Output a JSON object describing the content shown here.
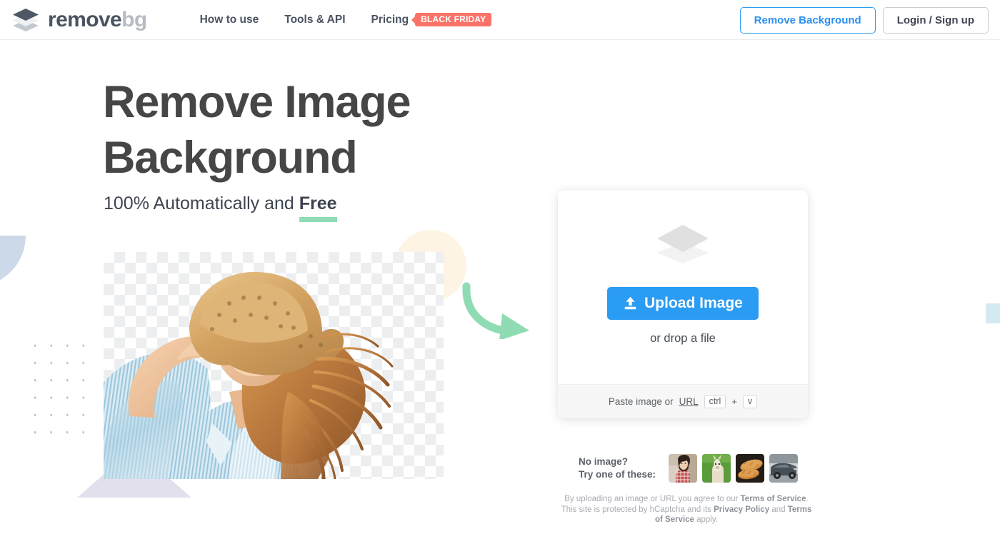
{
  "header": {
    "logo": {
      "name": "removebg-logo",
      "text_primary": "remove",
      "text_secondary": "bg"
    },
    "nav": [
      {
        "label": "How to use",
        "name": "nav-how-to-use"
      },
      {
        "label": "Tools & API",
        "name": "nav-tools-api"
      },
      {
        "label": "Pricing",
        "name": "nav-pricing"
      }
    ],
    "promo_badge": "BLACK FRIDAY",
    "promo_badge_color": "#fa7268",
    "remove_background_button": "Remove Background",
    "login_button": "Login / Sign up",
    "accent_blue": "#2a8ff0"
  },
  "hero": {
    "title_line1": "Remove Image",
    "title_line2": "Background",
    "subtitle_prefix": "100% Automatically and ",
    "subtitle_highlight": "Free",
    "highlight_underline_color": "#8fdcb4",
    "title_color": "#464646"
  },
  "upload": {
    "button_label": "Upload Image",
    "button_color": "#2b9cf4",
    "drop_text": "or drop a file",
    "paste_prefix": "Paste image or ",
    "paste_url_label": "URL",
    "key_ctrl": "ctrl",
    "key_plus": "+",
    "key_v": "v"
  },
  "samples": {
    "label_line1": "No image?",
    "label_line2": "Try one of these:",
    "thumbnails": [
      {
        "name": "sample-woman-plaid",
        "alt": "woman in plaid shirt"
      },
      {
        "name": "sample-alpaca",
        "alt": "alpaca on grass"
      },
      {
        "name": "sample-bread",
        "alt": "loaves of bread"
      },
      {
        "name": "sample-car",
        "alt": "dark grey car"
      }
    ]
  },
  "legal": {
    "part1": "By uploading an image or URL you agree to our ",
    "terms1": "Terms of Service",
    "part2": ". This site is protected by hCaptcha and its ",
    "privacy": "Privacy Policy",
    "part3": " and ",
    "terms2": "Terms of Service",
    "part4": " apply."
  }
}
